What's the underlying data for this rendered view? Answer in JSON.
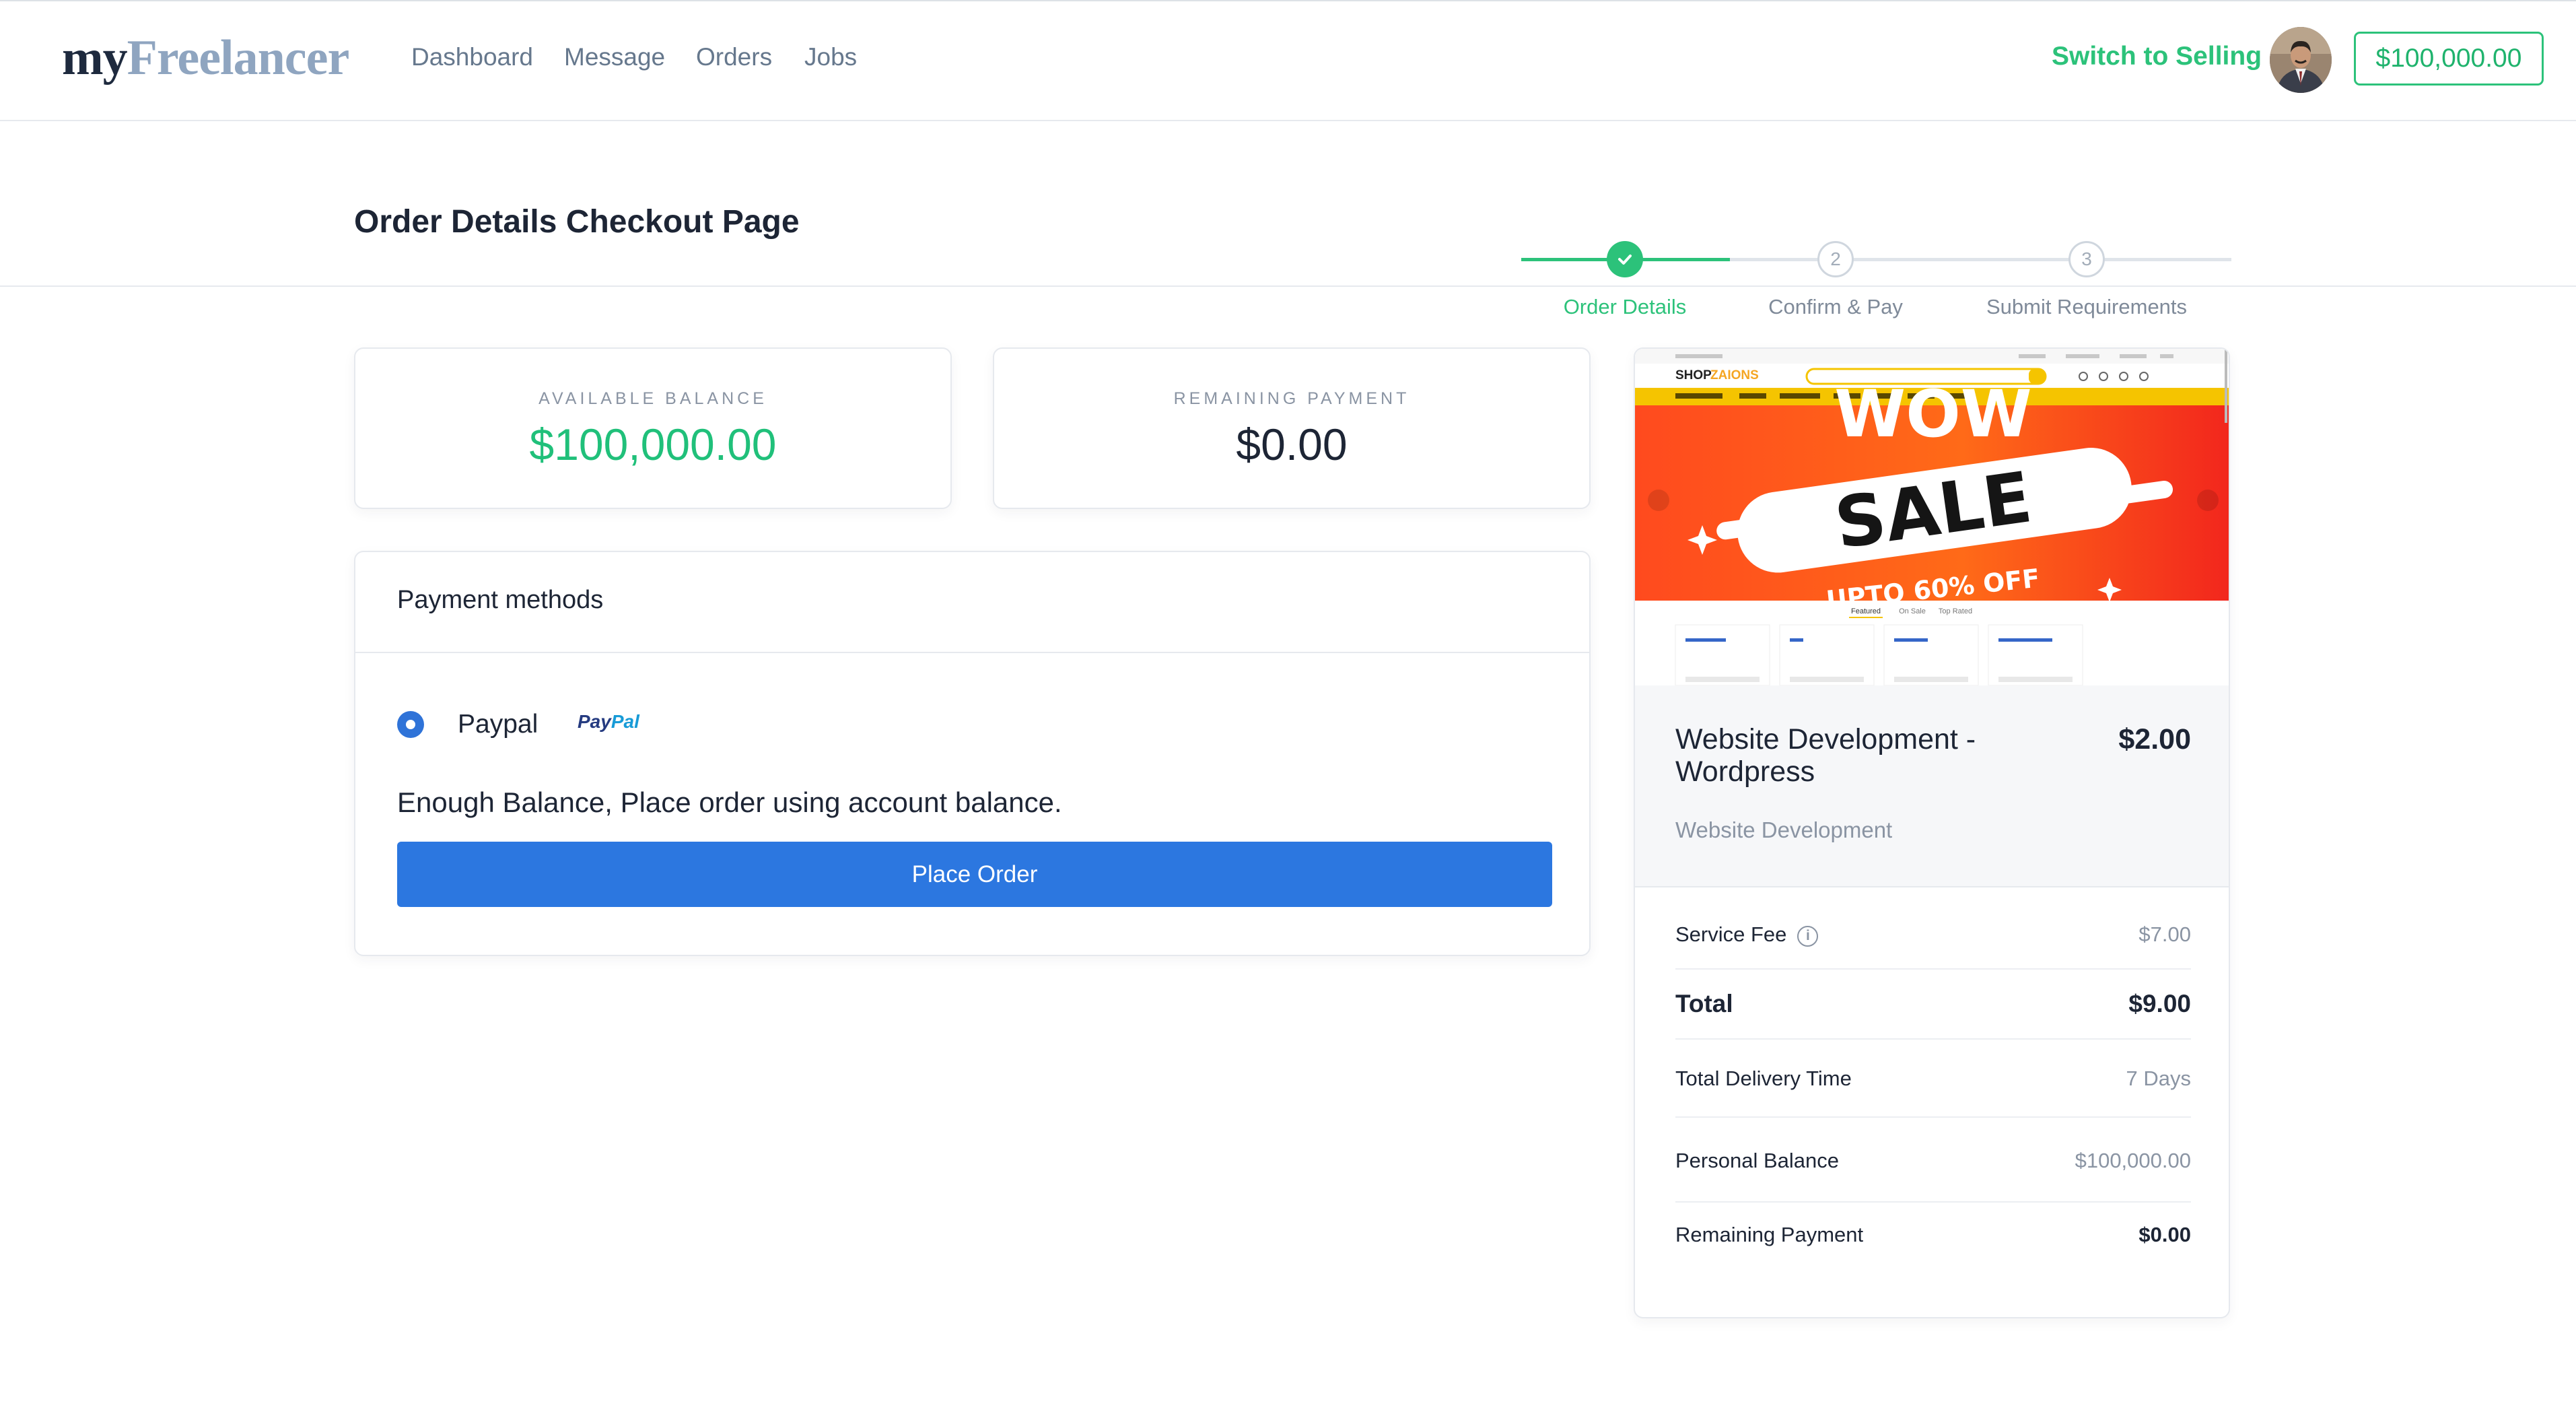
{
  "brand": {
    "logo_my": "my",
    "logo_freelancer": "Freelancer"
  },
  "nav": {
    "items": [
      "Dashboard",
      "Message",
      "Orders",
      "Jobs"
    ]
  },
  "header": {
    "switch_label": "Switch to Selling",
    "balance_button": "$100,000.00",
    "avatar_alt": "User avatar"
  },
  "page": {
    "title": "Order Details Checkout Page"
  },
  "stepper": {
    "steps": [
      {
        "number": "1",
        "label": "Order Details",
        "state": "complete"
      },
      {
        "number": "2",
        "label": "Confirm & Pay",
        "state": "pending"
      },
      {
        "number": "3",
        "label": "Submit Requirements",
        "state": "pending"
      }
    ]
  },
  "stats": {
    "available": {
      "label": "AVAILABLE BALANCE",
      "value": "$100,000.00"
    },
    "remaining": {
      "label": "REMAINING PAYMENT",
      "value": "$0.00"
    }
  },
  "payment": {
    "title": "Payment methods",
    "option_label": "Paypal",
    "logo_pay": "Pay",
    "logo_pal": "Pal",
    "message": "Enough Balance, Place order using account balance.",
    "button": "Place Order"
  },
  "gig": {
    "title": "Website Development - Wordpress",
    "price": "$2.00",
    "category": "Website Development",
    "thumbnail": {
      "shop_brand_a": "SHOP",
      "shop_brand_b": "ZAIONS",
      "banner_top": "WOW",
      "banner_main": "SALE",
      "banner_bottom": "UPTO 60% OFF",
      "tabs": [
        "Featured",
        "On Sale",
        "Top Rated"
      ]
    }
  },
  "summary": {
    "service_fee_label": "Service Fee",
    "service_fee_value": "$7.00",
    "total_label": "Total",
    "total_value": "$9.00",
    "delivery_label": "Total Delivery Time",
    "delivery_value": "7 Days",
    "personal_balance_label": "Personal Balance",
    "personal_balance_value": "$100,000.00",
    "remaining_label": "Remaining Payment",
    "remaining_value": "$0.00"
  },
  "colors": {
    "accent_green": "#2cc27a",
    "primary_blue": "#2c77e0",
    "text_dark": "#1d2535",
    "muted": "#8a94a3"
  }
}
